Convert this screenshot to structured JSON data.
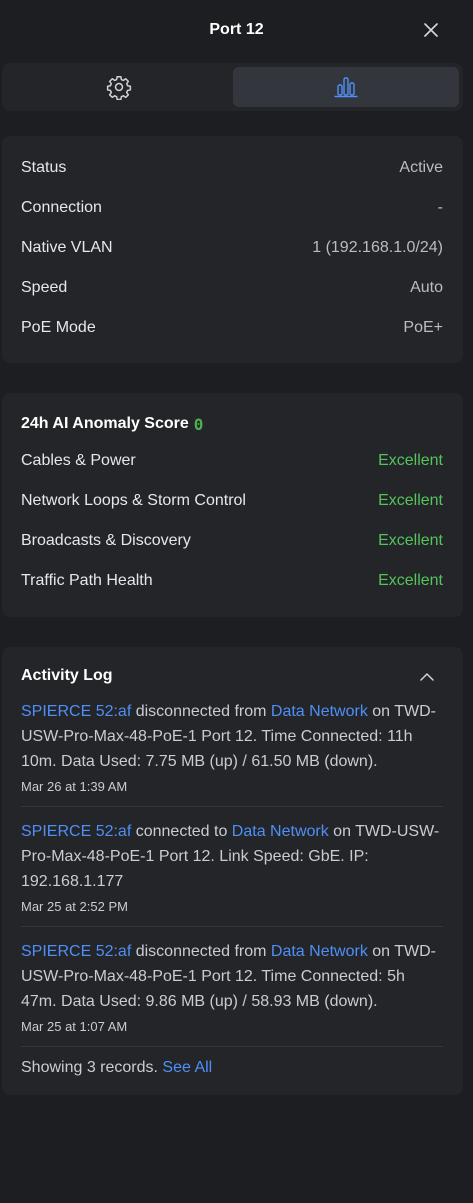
{
  "header": {
    "title": "Port 12"
  },
  "tabs": [
    {
      "icon": "gear-icon",
      "active": false
    },
    {
      "icon": "bar-chart-icon",
      "active": true
    }
  ],
  "status": [
    {
      "label": "Status",
      "value": "Active"
    },
    {
      "label": "Connection",
      "value": "-"
    },
    {
      "label": "Native VLAN",
      "value": "1 (192.168.1.0/24)"
    },
    {
      "label": "Speed",
      "value": "Auto"
    },
    {
      "label": "PoE Mode",
      "value": "PoE+"
    }
  ],
  "anomaly": {
    "title": "24h AI Anomaly Score",
    "score": "0",
    "items": [
      {
        "label": "Cables & Power",
        "value": "Excellent"
      },
      {
        "label": "Network Loops & Storm Control",
        "value": "Excellent"
      },
      {
        "label": "Broadcasts & Discovery",
        "value": "Excellent"
      },
      {
        "label": "Traffic Path Health",
        "value": "Excellent"
      }
    ]
  },
  "activity": {
    "title": "Activity Log",
    "entries": [
      {
        "device": "SPIERCE 52:af",
        "action": " disconnected from ",
        "network": "Data Network",
        "rest": " on TWD-USW-Pro-Max-48-PoE-1 Port 12. Time Connected: 11h 10m. Data Used: 7.75 MB (up) / 61.50 MB (down).",
        "time": "Mar 26 at 1:39 AM"
      },
      {
        "device": "SPIERCE 52:af",
        "action": " connected to ",
        "network": "Data Network",
        "rest": " on TWD-USW-Pro-Max-48-PoE-1 Port 12. Link Speed: GbE. IP: 192.168.1.177",
        "time": "Mar 25 at 2:52 PM"
      },
      {
        "device": "SPIERCE 52:af",
        "action": " disconnected from ",
        "network": "Data Network",
        "rest": " on TWD-USW-Pro-Max-48-PoE-1 Port 12. Time Connected: 5h 47m. Data Used: 9.86 MB (up) / 58.93 MB (down).",
        "time": "Mar 25 at 1:07 AM"
      }
    ],
    "footer_text": "Showing 3 records. ",
    "see_all": "See All"
  },
  "colors": {
    "accent": "#4f8ff7",
    "good": "#55c45a",
    "panel": "#232529",
    "background": "#1c1e21"
  }
}
